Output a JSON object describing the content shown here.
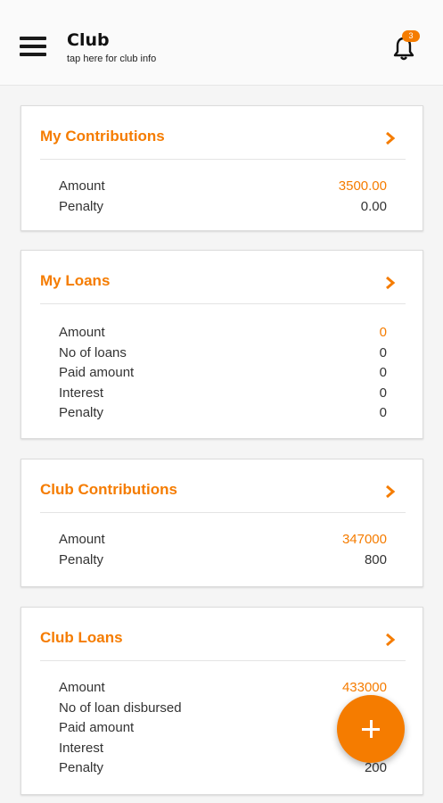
{
  "header": {
    "title": "Club",
    "subtitle": "tap here for club info",
    "notification_count": "3",
    "menu_icon": "hamburger-menu-icon",
    "bell_icon": "bell-icon"
  },
  "colors": {
    "accent": "#f57c00"
  },
  "cards": [
    {
      "title": "My Contributions",
      "rows": [
        {
          "label": "Amount",
          "value": "3500.00"
        },
        {
          "label": "Penalty",
          "value": "0.00"
        }
      ]
    },
    {
      "title": "My Loans",
      "rows": [
        {
          "label": "Amount",
          "value": "0"
        },
        {
          "label": "No of loans",
          "value": "0"
        },
        {
          "label": "Paid amount",
          "value": "0"
        },
        {
          "label": "Interest",
          "value": "0"
        },
        {
          "label": "Penalty",
          "value": "0"
        }
      ]
    },
    {
      "title": "Club Contributions",
      "rows": [
        {
          "label": "Amount",
          "value": "347000"
        },
        {
          "label": "Penalty",
          "value": "800"
        }
      ]
    },
    {
      "title": "Club Loans",
      "rows": [
        {
          "label": "Amount",
          "value": "433000"
        },
        {
          "label": "No of loan disbursed",
          "value": ""
        },
        {
          "label": "Paid amount",
          "value": ""
        },
        {
          "label": "Interest",
          "value": ""
        },
        {
          "label": "Penalty",
          "value": "200"
        }
      ]
    }
  ],
  "fab": {
    "icon": "plus-icon"
  }
}
